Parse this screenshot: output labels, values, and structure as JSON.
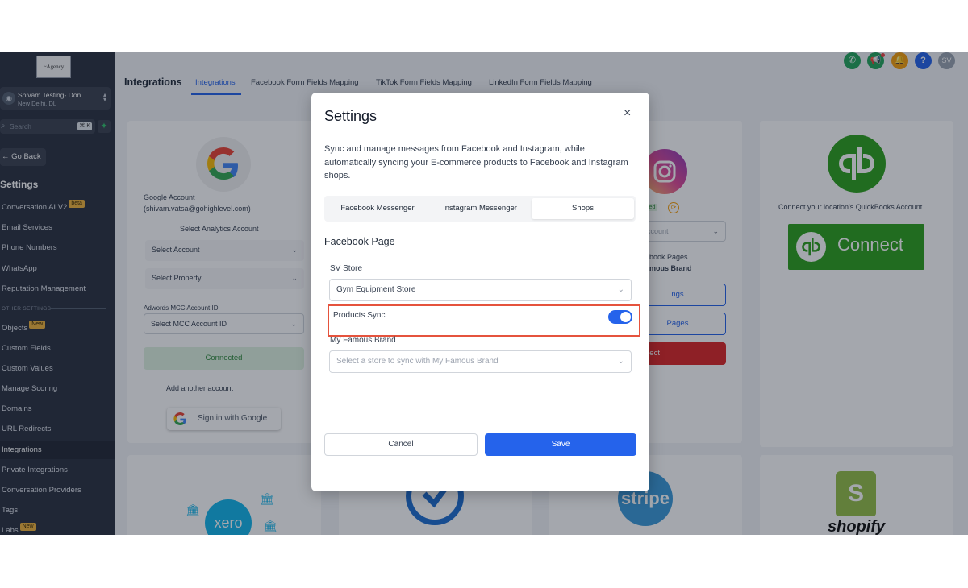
{
  "sidebar": {
    "logo": "~Agency",
    "account_name": "Shivam Testing- Don...",
    "account_location": "New Delhi, DL",
    "search_placeholder": "Search",
    "search_shortcut": "⌘ K",
    "go_back": "← Go Back",
    "settings_heading": "Settings",
    "items": [
      {
        "label": "Conversation AI V2",
        "badge": "beta"
      },
      {
        "label": "Email Services"
      },
      {
        "label": "Phone Numbers"
      },
      {
        "label": "WhatsApp"
      },
      {
        "label": "Reputation Management"
      },
      {
        "label": "Objects",
        "badge": "New"
      },
      {
        "label": "Custom Fields"
      },
      {
        "label": "Custom Values"
      },
      {
        "label": "Manage Scoring"
      },
      {
        "label": "Domains"
      },
      {
        "label": "URL Redirects"
      },
      {
        "label": "Integrations"
      },
      {
        "label": "Private Integrations"
      },
      {
        "label": "Conversation Providers"
      },
      {
        "label": "Tags"
      },
      {
        "label": "Labs",
        "badge": "New"
      }
    ],
    "other_settings": "OTHER SETTINGS"
  },
  "header": {
    "title": "Integrations",
    "tabs": [
      "Integrations",
      "Facebook Form Fields Mapping",
      "TikTok Form Fields Mapping",
      "LinkedIn Form Fields Mapping"
    ],
    "avatar_initials": "SV",
    "icon_colors": {
      "phone": "#22a55b",
      "megaphone": "#22a55b",
      "bell": "#f59e0b",
      "help": "#2563eb"
    }
  },
  "google_card": {
    "account_label": "Google Account",
    "account_email": "(shivam.vatsa@gohighlevel.com)",
    "analytics_label": "Select Analytics Account",
    "select_account": "Select Account",
    "select_property": "Select Property",
    "adwords_label": "Adwords MCC Account ID",
    "select_mcc": "Select MCC Account ID",
    "connected": "Connected",
    "add_another": "Add another account",
    "sign_in": "Sign in with Google"
  },
  "instagram_card": {
    "status_tag": "led",
    "select_account": "d Account",
    "pages_label": "ebook Pages",
    "brand": "amous Brand",
    "btn_settings": "ngs",
    "btn_pages": "Pages",
    "btn_disconnect": "nect"
  },
  "quickbooks_card": {
    "description": "Connect your location's QuickBooks Account",
    "connect": "Connect",
    "brand_color": "#2ca01c"
  },
  "bottom_cards": {
    "xero": "xero",
    "stripe": "stripe",
    "shopify": "shopify"
  },
  "modal": {
    "title": "Settings",
    "close": "×",
    "description": "Sync and manage messages from Facebook and Instagram, while automatically syncing your E-commerce products to Facebook and Instagram shops.",
    "tabs": [
      {
        "label": "Facebook Messenger",
        "active": false
      },
      {
        "label": "Instagram Messenger",
        "active": false
      },
      {
        "label": "Shops",
        "active": true
      }
    ],
    "section": "Facebook Page",
    "store_label": "SV Store",
    "store_value": "Gym Equipment Store",
    "products_sync_label": "Products Sync",
    "products_sync_on": true,
    "brand_label": "My Famous Brand",
    "brand_placeholder": "Select a store to sync with My Famous Brand",
    "cancel": "Cancel",
    "save": "Save",
    "accent_color": "#2563eb",
    "highlight_color": "#e5533d"
  }
}
